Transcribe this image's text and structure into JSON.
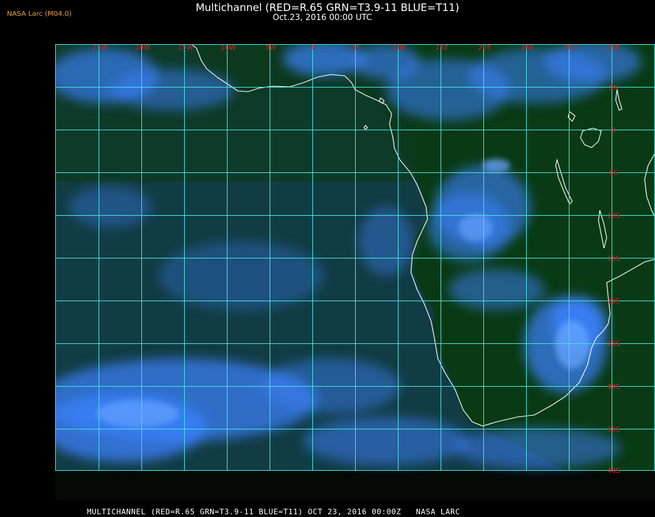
{
  "header": {
    "title": "Multichannel (RED=R.65 GRN=T3.9-11 BLUE=T11)",
    "subtitle": "Oct.23, 2016 00:00 UTC",
    "brand": "NASA Larc (M04.0)"
  },
  "footer": {
    "caption": "MULTICHANNEL (RED=R.65 GRN=T3.9-11 BLUE=T11) OCT 23, 2016 00:00Z   NASA LARC"
  },
  "map": {
    "lon_labels": [
      "25W",
      "20W",
      "15W",
      "10W",
      "5W",
      "0",
      "5E",
      "10E",
      "15E",
      "20E",
      "25E",
      "30E",
      "35E"
    ],
    "lat_labels": [
      "5N",
      "0",
      "5S",
      "10S",
      "15S",
      "20S",
      "25S",
      "30S",
      "35S",
      "40S"
    ],
    "colors": {
      "grid": "#40e0e0",
      "label": "#e02020",
      "coast": "#ffffff",
      "land": "#0a3a14",
      "ocean": "#123c44",
      "cloud": "#3c82ff"
    }
  }
}
